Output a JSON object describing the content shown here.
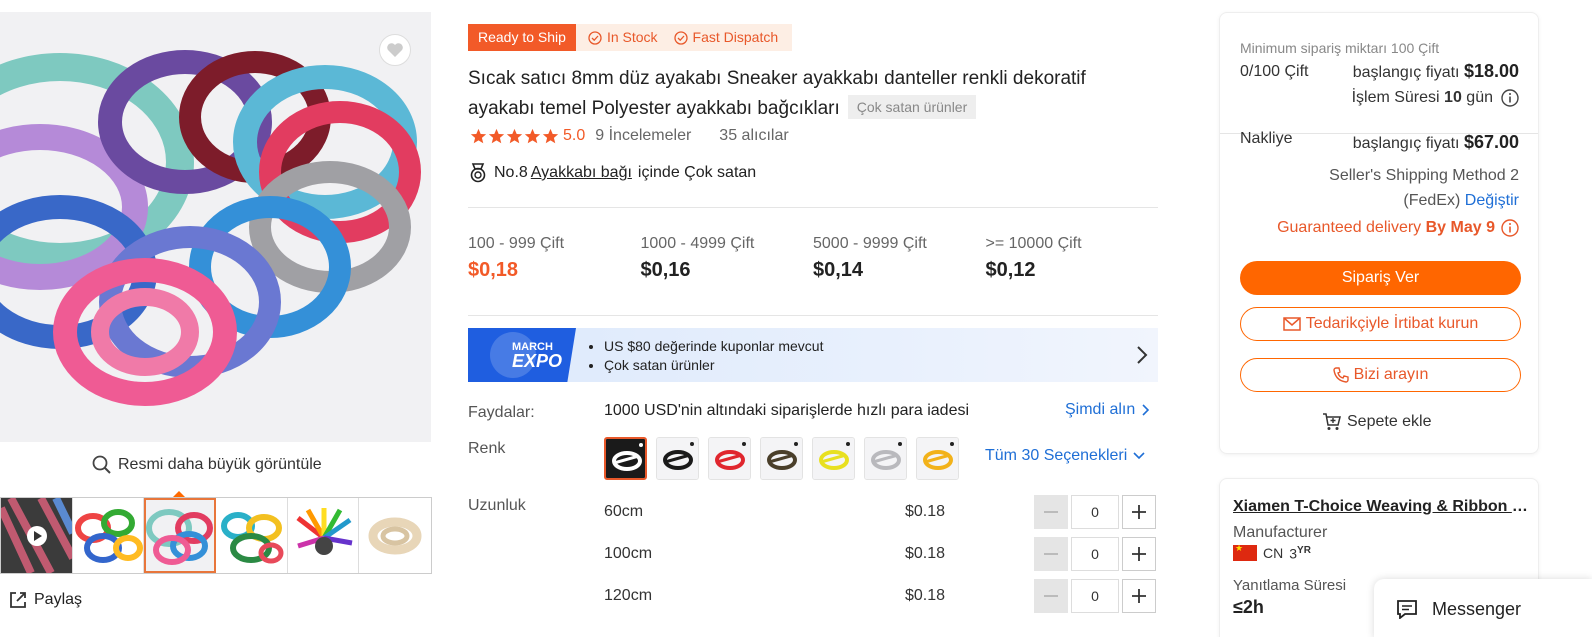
{
  "gallery": {
    "zoom_label": "Resmi daha büyük görüntüle",
    "share_label": "Paylaş"
  },
  "product": {
    "badge_ready": "Ready to Ship",
    "badge_stock": "In Stock",
    "badge_dispatch": "Fast Dispatch",
    "title": "Sıcak satıcı 8mm düz ayakabı Sneaker ayakkabı danteller renkli dekoratif ayakabı temel Polyester ayakkabı bağcıkları",
    "title_tag": "Çok satan ürünler",
    "rating_score": "5.0",
    "rating_value": 5,
    "reviews": "9 İncelemeler",
    "buyers": "35 alıcılar",
    "bestseller_prefix": "No.8",
    "bestseller_category": "Ayakkabı bağı",
    "bestseller_suffix": "içinde Çok satan"
  },
  "price_tiers": [
    {
      "range": "100 - 999 Çift",
      "price": "$0,18"
    },
    {
      "range": "1000 - 4999 Çift",
      "price": "$0,16"
    },
    {
      "range": "5000 - 9999 Çift",
      "price": "$0,14"
    },
    {
      "range": ">= 10000 Çift",
      "price": "$0,12"
    }
  ],
  "expo": {
    "logo_line1": "MARCH",
    "logo_line2": "EXPO",
    "items": [
      "US $80 değerinde kuponlar mevcut",
      "Çok satan ürünler"
    ]
  },
  "benefits": {
    "label": "Faydalar:",
    "text": "1000 USD'nin altındaki siparişlerde hızlı para iadesi",
    "link": "Şimdi alın"
  },
  "color": {
    "label": "Renk",
    "all_options": "Tüm 30 Seçenekleri",
    "swatches": [
      "#ffffff",
      "#1a1a1a",
      "#e0262e",
      "#4a3f2a",
      "#e8e020",
      "#b9b9bd",
      "#f2b21a"
    ]
  },
  "length": {
    "label": "Uzunluk",
    "rows": [
      {
        "name": "60cm",
        "price": "$0.18",
        "qty": "0"
      },
      {
        "name": "100cm",
        "price": "$0.18",
        "qty": "0"
      },
      {
        "name": "120cm",
        "price": "$0.18",
        "qty": "0"
      }
    ]
  },
  "order": {
    "min_order": "Minimum sipariş miktarı 100 Çift",
    "progress": "0/100 Çift",
    "start_prefix": "başlangıç fiyatı",
    "start_price": "$18.00",
    "lead_prefix": "İşlem Süresi",
    "lead_days": "10",
    "lead_suffix": "gün",
    "shipping_label": "Nakliye",
    "shipping_prefix": "başlangıç fiyatı",
    "shipping_price": "$67.00",
    "shipping_method_line1": "Seller's Shipping Method 2",
    "shipping_method_line2": "(FedEx)",
    "change_link": "Değiştir",
    "guarantee_prefix": "Guaranteed delivery",
    "guarantee_date": "By May 9",
    "btn_order": "Sipariş Ver",
    "btn_contact": "Tedarikçiyle İrtibat kurun",
    "btn_call": "Bizi arayın",
    "add_cart": "Sepete ekle"
  },
  "supplier": {
    "name": "Xiamen T-Choice Weaving & Ribbon Co., Ltd.",
    "type": "Manufacturer",
    "country": "CN",
    "years": "3",
    "years_unit": "YR",
    "response_label": "Yanıtlama Süresi",
    "response_value": "≤2h"
  },
  "messenger": {
    "label": "Messenger"
  },
  "colors": {
    "accent": "#ff6600",
    "link": "#1f6fd6",
    "price_hot": "#f25a28"
  }
}
